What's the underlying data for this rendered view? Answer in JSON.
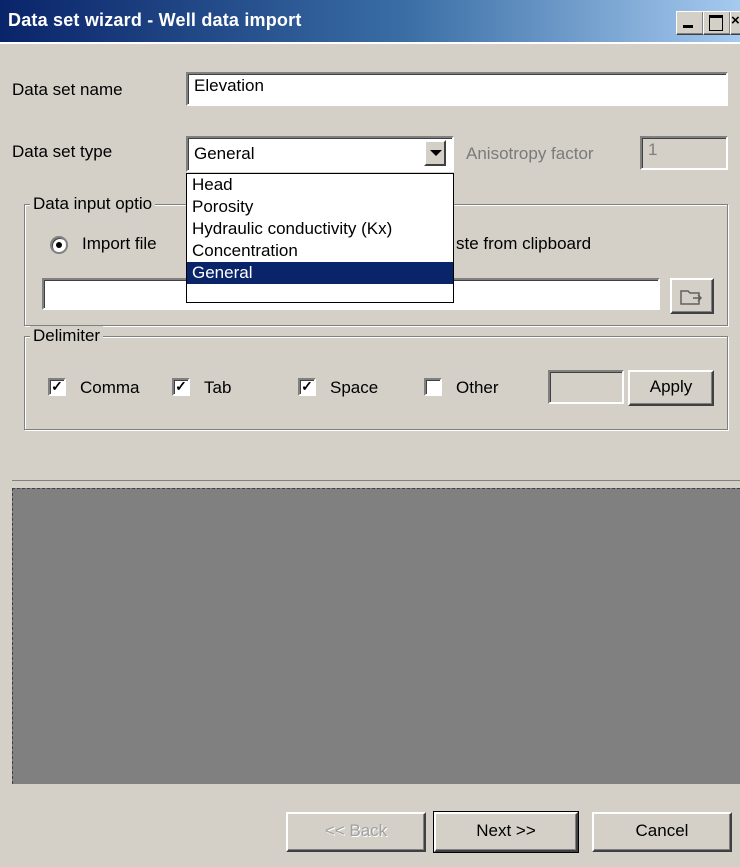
{
  "window": {
    "title": "Data set wizard - Well data import",
    "minimize_icon": "minimize-icon",
    "maximize_icon": "maximize-icon",
    "close_icon": "close-icon"
  },
  "form": {
    "name_label": "Data set name",
    "name_value": "Elevation",
    "type_label": "Data set type",
    "type_value": "General",
    "anisotropy_label": "Anisotropy factor",
    "anisotropy_value": "1"
  },
  "dropdown": {
    "options": [
      "Head",
      "Porosity",
      "Hydraulic conductivity (Kx)",
      "Concentration",
      "General"
    ],
    "selected": "General"
  },
  "input_options": {
    "group_label": "Data input options",
    "visible_label_fragment": "Data input optio",
    "import_file_label": "Import file",
    "import_file_checked": true,
    "paste_label_fragment": "ste from clipboard",
    "file_path": "",
    "browse_icon": "folder-browse-icon"
  },
  "delimiter": {
    "group_label": "Delimiter",
    "comma_label": "Comma",
    "comma_checked": true,
    "tab_label": "Tab",
    "tab_checked": true,
    "space_label": "Space",
    "space_checked": true,
    "other_label": "Other",
    "other_checked": false,
    "other_value": "",
    "apply_label": "Apply"
  },
  "footer": {
    "back_label": "<< Back",
    "next_label": "Next >>",
    "cancel_label": "Cancel"
  },
  "colors": {
    "title_start": "#0a246a",
    "title_end": "#a6caf0",
    "face": "#d4d0c8",
    "selection": "#0a246a",
    "grid_bg": "#808080"
  }
}
